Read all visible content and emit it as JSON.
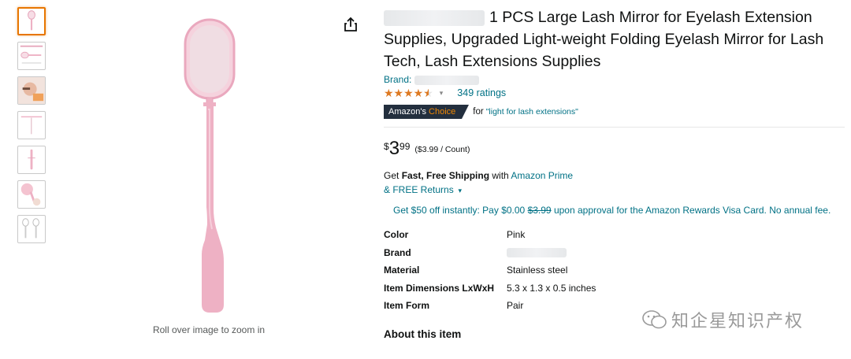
{
  "gallery": {
    "zoom_hint": "Roll over image to zoom in",
    "thumb_count": 7,
    "product_color": "#eeb1c4"
  },
  "product": {
    "title": "1 PCS Large Lash Mirror for Eyelash Extension Supplies, Upgraded Light-weight Folding Eyelash Mirror for Lash Tech, Lash Extensions Supplies",
    "brand_label": "Brand:",
    "rating_stars": 4.5,
    "ratings_count": "349 ratings",
    "choice_badge_prefix": "Amazon's",
    "choice_badge_suffix": "Choice",
    "choice_for": "for",
    "choice_keyword": "\"light for lash extensions\"",
    "price_symbol": "$",
    "price_whole": "3",
    "price_fraction": "99",
    "price_per_unit": "($3.99 / Count)"
  },
  "shipping": {
    "get": "Get",
    "fast_free": "Fast, Free Shipping",
    "with": "with",
    "prime": "Amazon Prime",
    "returns": "& FREE Returns"
  },
  "offer": {
    "text_a": "Get $50 off instantly: Pay $0.00",
    "strike": "$3.99",
    "text_b": "upon approval for the Amazon Rewards Visa Card. No annual fee."
  },
  "attributes": [
    {
      "label": "Color",
      "value": "Pink"
    },
    {
      "label": "Brand",
      "value": ""
    },
    {
      "label": "Material",
      "value": "Stainless steel"
    },
    {
      "label": "Item Dimensions LxWxH",
      "value": "5.3 x 1.3 x 0.5 inches"
    },
    {
      "label": "Item Form",
      "value": "Pair"
    }
  ],
  "about_heading": "About this item",
  "watermark": "知企星知识产权",
  "colors": {
    "link": "#007185",
    "star": "#de7921",
    "badge_bg": "#232f3e",
    "badge_accent": "#f08804",
    "thumb_active": "#e77600"
  }
}
